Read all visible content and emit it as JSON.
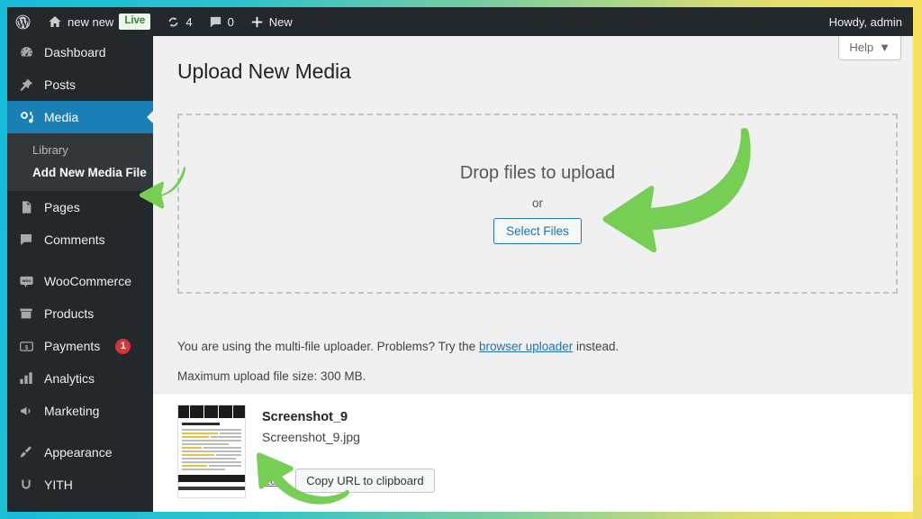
{
  "theme": {
    "accent_blue": "#1a7fb5",
    "admin_dark": "#23282d",
    "submenu_dark": "#32373c",
    "content_bg": "#f0f0f1",
    "link_blue": "#2271b1",
    "badge_red": "#d63638",
    "arrow_green": "#76ce55",
    "frame_cyan": "#16bcd9",
    "frame_yellow": "#f7e05e"
  },
  "adminbar": {
    "logo": "wordpress-logo",
    "site_name": "new new",
    "live_badge": "Live",
    "updates_icon": "updates-icon",
    "updates_count": "4",
    "comments_icon": "comments-icon",
    "comments_count": "0",
    "new_icon": "plus-icon",
    "new_label": "New",
    "howdy": "Howdy, admin"
  },
  "sidebar": {
    "items": [
      {
        "label": "Dashboard",
        "icon": "dashboard-icon",
        "active": false
      },
      {
        "label": "Posts",
        "icon": "pin-icon",
        "active": false
      },
      {
        "label": "Media",
        "icon": "media-icon",
        "active": true
      },
      {
        "label": "Pages",
        "icon": "pages-icon",
        "active": false
      },
      {
        "label": "Comments",
        "icon": "comments-icon",
        "active": false
      },
      {
        "label": "WooCommerce",
        "icon": "woo-icon",
        "active": false
      },
      {
        "label": "Products",
        "icon": "products-icon",
        "active": false
      },
      {
        "label": "Payments",
        "icon": "payments-icon",
        "active": false,
        "badge": "1"
      },
      {
        "label": "Analytics",
        "icon": "analytics-icon",
        "active": false
      },
      {
        "label": "Marketing",
        "icon": "marketing-icon",
        "active": false
      },
      {
        "label": "Appearance",
        "icon": "appearance-icon",
        "active": false
      },
      {
        "label": "YITH",
        "icon": "yith-icon",
        "active": false
      }
    ],
    "submenu": [
      {
        "label": "Library",
        "current": false
      },
      {
        "label": "Add New Media File",
        "current": true
      }
    ]
  },
  "content": {
    "help_tab": "Help",
    "help_caret": "▼",
    "page_title": "Upload New Media",
    "dropzone": {
      "title": "Drop files to upload",
      "or": "or",
      "select_button": "Select Files"
    },
    "uploader_note_pre": "You are using the multi-file uploader. Problems? Try the ",
    "uploader_note_link": "browser uploader",
    "uploader_note_post": " instead.",
    "max_upload": "Maximum upload file size: 300 MB."
  },
  "upload_list": {
    "file": {
      "title": "Screenshot_9",
      "filename": "Screenshot_9.jpg",
      "edit_label": "Edit",
      "copy_label": "Copy URL to clipboard",
      "thumbnail": "document-screenshot-thumbnail"
    }
  },
  "annotations": {
    "arrows": [
      {
        "name": "arrow-pointing-to-add-new-media-file",
        "direction": "left"
      },
      {
        "name": "arrow-pointing-to-select-files",
        "direction": "left"
      },
      {
        "name": "arrow-pointing-to-edit-link",
        "direction": "up-left"
      }
    ]
  }
}
